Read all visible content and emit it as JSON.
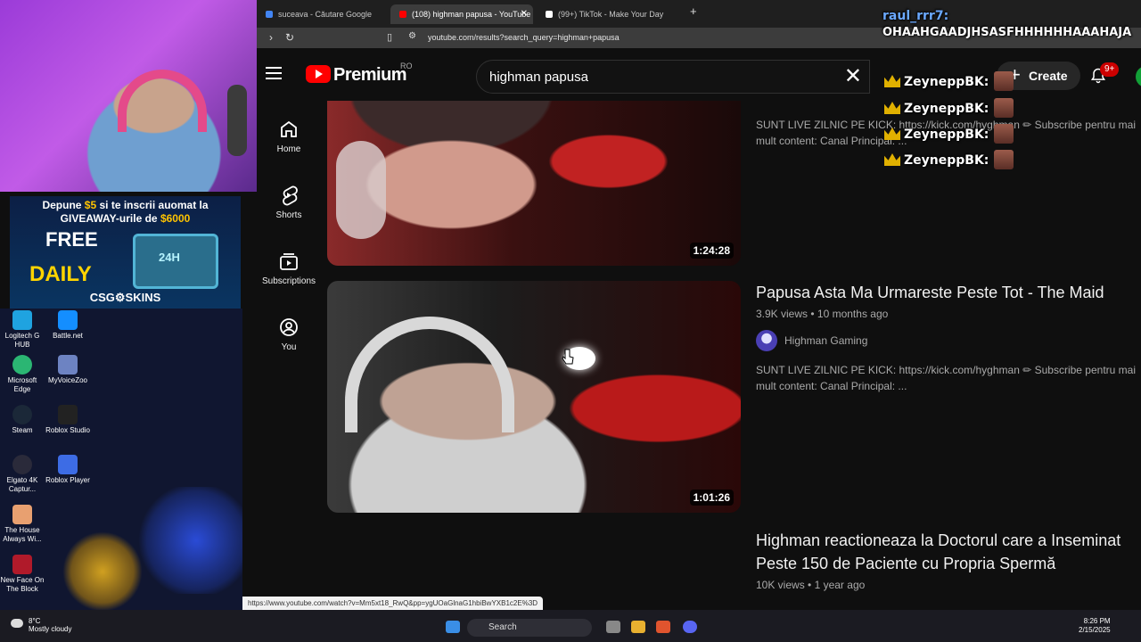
{
  "browser": {
    "tabs": [
      {
        "title": "suceava - Căutare Google",
        "favicon_color": "#4285f4"
      },
      {
        "title": "(108) highman papusa - YouTube",
        "favicon_color": "#ff0000"
      },
      {
        "title": "(99+) TikTok - Make Your Day",
        "favicon_color": "#ffffff"
      }
    ],
    "url": "youtube.com/results?search_query=highman+papusa"
  },
  "youtube": {
    "logo_text": "Premium",
    "country_code": "RO",
    "search_value": "highman papusa",
    "create_label": "Create",
    "notification_count": "9+",
    "sidebar": [
      {
        "label": "Home",
        "icon": "home-icon"
      },
      {
        "label": "Shorts",
        "icon": "shorts-icon"
      },
      {
        "label": "Subscriptions",
        "icon": "subscriptions-icon"
      },
      {
        "label": "You",
        "icon": "you-icon"
      }
    ],
    "results": [
      {
        "title": "",
        "duration": "1:24:28",
        "views": "",
        "age": "",
        "channel": "",
        "description": "SUNT LIVE ZILNIC PE KICK: https://kick.com/hyghman ✏ Subscribe pentru mai mult content: Canal Principal: ..."
      },
      {
        "title": "Papusa Asta Ma Urmareste Peste Tot - The Maid",
        "duration": "1:01:26",
        "views": "3.9K views",
        "age": "10 months ago",
        "channel": "Highman Gaming",
        "description": "SUNT LIVE ZILNIC PE KICK: https://kick.com/hyghman ✏ Subscribe pentru mai mult content: Canal Principal: ..."
      },
      {
        "title": "Highman reactioneaza la Doctorul care a Inseminat Peste 150 de Paciente cu Propria Spermă",
        "views": "10K views",
        "age": "1 year ago"
      }
    ]
  },
  "status_url": "https://www.youtube.com/watch?v=Mm5xt18_RwQ&pp=ygUOaGlnaG1hbiBwYXB1c2E%3D",
  "chat": {
    "first_user": "raul_rrr7:",
    "first_message": "OHAAHGAADJHSASFHHHHHHAAAHAJA",
    "repeat_user": "ZeyneppBK:"
  },
  "overlay_ad": {
    "line1_prefix": "Depune ",
    "line1_amount": "$5",
    "line1_suffix": " si te inscrii auomat la",
    "line2_prefix": "GIVEAWAY-urile de ",
    "line2_amount": "$6000",
    "free": "FREE",
    "daily": "DAILY",
    "box_label": "24H",
    "brand": "CSG⚙SKINS"
  },
  "desktop_icons": [
    {
      "label": "Logitech G HUB",
      "color": "#1fa3e0"
    },
    {
      "label": "Battle.net",
      "color": "#148eff"
    },
    {
      "label": "Microsoft Edge",
      "color": "#2bb673"
    },
    {
      "label": "MyVoiceZoo",
      "color": "#6d83c2"
    },
    {
      "label": "Steam",
      "color": "#1b2838"
    },
    {
      "label": "Roblox Studio",
      "color": "#222222"
    },
    {
      "label": "Elgato 4K Captur...",
      "color": "#2a2a3a"
    },
    {
      "label": "Roblox Player",
      "color": "#3d6ce5"
    },
    {
      "label": "The House Always Wi...",
      "color": "#e8a070"
    },
    {
      "label": "New Face On The Block",
      "color": "#b01a2a"
    }
  ],
  "taskbar": {
    "weather_temp": "8°C",
    "weather_desc": "Mostly cloudy",
    "search_label": "Search",
    "time": "8:26 PM",
    "date": "2/15/2025"
  }
}
